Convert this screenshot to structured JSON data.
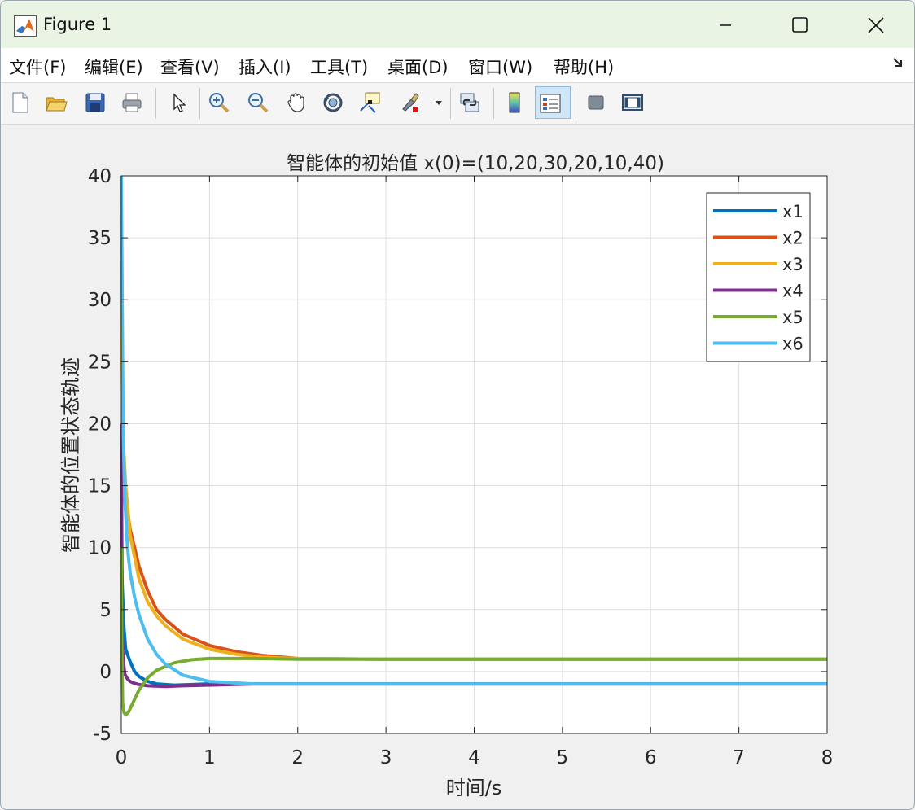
{
  "window": {
    "title": "Figure 1"
  },
  "menu": [
    "文件(F)",
    "编辑(E)",
    "查看(V)",
    "插入(I)",
    "工具(T)",
    "桌面(D)",
    "窗口(W)",
    "帮助(H)"
  ],
  "toolbar": {
    "icons": [
      "new-file-icon",
      "open-folder-icon",
      "save-icon",
      "print-icon",
      "pointer-icon",
      "zoom-in-icon",
      "zoom-out-icon",
      "pan-hand-icon",
      "rotate-3d-icon",
      "data-cursor-icon",
      "brush-icon",
      "link-plot-icon",
      "colorbar-icon",
      "legend-icon",
      "hide-plot-tools-icon",
      "show-plot-tools-icon"
    ]
  },
  "colors": {
    "x1": "#0072bd",
    "x2": "#d95319",
    "x3": "#edb120",
    "x4": "#7e2f8e",
    "x5": "#77ac30",
    "x6": "#4dbeee"
  },
  "chart_data": {
    "type": "line",
    "title": "智能体的初始值 x(0)=(10,20,30,20,10,40)",
    "xlabel": "时间/s",
    "ylabel": "智能体的位置状态轨迹",
    "xlim": [
      0,
      8
    ],
    "ylim": [
      -5,
      40
    ],
    "xticks": [
      0,
      1,
      2,
      3,
      4,
      5,
      6,
      7,
      8
    ],
    "yticks": [
      -5,
      0,
      5,
      10,
      15,
      20,
      25,
      30,
      35,
      40
    ],
    "grid": true,
    "legend_position": "top-right",
    "series": [
      {
        "name": "x1",
        "x": [
          0,
          0.01,
          0.03,
          0.05,
          0.1,
          0.15,
          0.2,
          0.3,
          0.4,
          0.6,
          0.8,
          1.0,
          1.5,
          2,
          8
        ],
        "y": [
          10,
          7,
          3.5,
          1.8,
          0.8,
          0.0,
          -0.4,
          -0.8,
          -1.0,
          -1.1,
          -1.05,
          -1.0,
          -1.0,
          -1.0,
          -1.0
        ]
      },
      {
        "name": "x2",
        "x": [
          0,
          0.02,
          0.05,
          0.1,
          0.2,
          0.3,
          0.4,
          0.5,
          0.7,
          1.0,
          1.3,
          1.6,
          2.0,
          3,
          8
        ],
        "y": [
          20,
          17,
          14,
          11.5,
          8.5,
          6.5,
          5.0,
          4.2,
          3.0,
          2.1,
          1.6,
          1.3,
          1.05,
          1.0,
          1.0
        ]
      },
      {
        "name": "x3",
        "x": [
          0,
          0.02,
          0.05,
          0.1,
          0.2,
          0.3,
          0.4,
          0.5,
          0.7,
          1.0,
          1.3,
          1.6,
          2.0,
          3,
          8
        ],
        "y": [
          30,
          19,
          15,
          11,
          7.5,
          5.6,
          4.5,
          3.7,
          2.6,
          1.8,
          1.4,
          1.15,
          1.05,
          1.0,
          1.0
        ]
      },
      {
        "name": "x4",
        "x": [
          0,
          0.01,
          0.02,
          0.04,
          0.07,
          0.1,
          0.15,
          0.2,
          0.3,
          0.5,
          0.7,
          1.0,
          1.5,
          2,
          8
        ],
        "y": [
          20,
          3,
          1,
          -0.2,
          -0.6,
          -0.8,
          -0.95,
          -1.05,
          -1.15,
          -1.2,
          -1.15,
          -1.1,
          -1.0,
          -1.0,
          -1.0
        ]
      },
      {
        "name": "x5",
        "x": [
          0,
          0.005,
          0.015,
          0.03,
          0.05,
          0.08,
          0.12,
          0.2,
          0.3,
          0.4,
          0.6,
          0.8,
          1.0,
          1.5,
          2,
          8
        ],
        "y": [
          10,
          2.5,
          -2.5,
          -3.3,
          -3.5,
          -3.3,
          -2.7,
          -1.5,
          -0.5,
          0.1,
          0.7,
          0.95,
          1.05,
          1.05,
          1.0,
          1.0
        ]
      },
      {
        "name": "x6",
        "x": [
          0,
          0.01,
          0.02,
          0.04,
          0.07,
          0.1,
          0.15,
          0.2,
          0.3,
          0.4,
          0.5,
          0.7,
          1.0,
          1.5,
          2,
          8
        ],
        "y": [
          40,
          30,
          20,
          14,
          10,
          8,
          6,
          4.6,
          2.6,
          1.4,
          0.6,
          -0.3,
          -0.8,
          -1.0,
          -1.0,
          -1.0
        ]
      }
    ]
  }
}
